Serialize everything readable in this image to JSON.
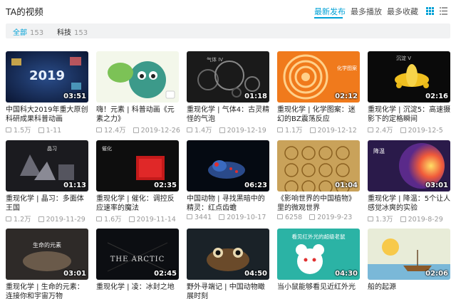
{
  "header": {
    "title": "TA的视频",
    "sort_options": [
      "最新发布",
      "最多播放",
      "最多收藏"
    ],
    "active_sort": "最新发布",
    "view_icons": [
      "grid-view-icon",
      "list-view-icon"
    ]
  },
  "filter": {
    "items": [
      {
        "label": "全部",
        "count": "153"
      },
      {
        "label": "科技",
        "count": "153"
      }
    ]
  },
  "videos": [
    {
      "title": "中国科大2019年重大原创科研成果科普动画",
      "duration": "03:51",
      "plays": "1.5万",
      "date": "1-11",
      "thumb_label": "2019"
    },
    {
      "title": "嗨！元素 | 科普动画《元素之力》",
      "duration": "",
      "plays": "12.4万",
      "date": "2019-12-26",
      "thumb_label": ""
    },
    {
      "title": "重现化学 | 气体4：古灵精怪的气泡",
      "duration": "01:18",
      "plays": "1.4万",
      "date": "2019-12-19",
      "thumb_label": "气体 IV"
    },
    {
      "title": "重现化学 | 化学图案：迷幻的BZ震荡反应",
      "duration": "02:12",
      "plays": "1.1万",
      "date": "2019-12-12",
      "thumb_label": "化学图案"
    },
    {
      "title": "重现化学 | 沉淀5：高速摄影下的定格瞬间",
      "duration": "02:16",
      "plays": "2.4万",
      "date": "2019-12-5",
      "thumb_label": "沉淀 V"
    },
    {
      "title": "重现化学 | 晶习：多面体王国",
      "duration": "01:13",
      "plays": "1.2万",
      "date": "2019-11-29",
      "thumb_label": "晶习"
    },
    {
      "title": "重现化学 | 催化：调控反应速率的魔法",
      "duration": "02:35",
      "plays": "1.6万",
      "date": "2019-11-14",
      "thumb_label": "催化"
    },
    {
      "title": "中国动物 | 寻找黑暗中的精灵：红点齿蟾",
      "duration": "06:23",
      "plays": "3441",
      "date": "2019-10-17",
      "thumb_label": ""
    },
    {
      "title": "《影响世界的中国植物》里的微观世界",
      "duration": "01:04",
      "plays": "6258",
      "date": "2019-9-23",
      "thumb_label": ""
    },
    {
      "title": "重现化学 | 降温：5个让人感觉冰爽的实验",
      "duration": "03:01",
      "plays": "1.3万",
      "date": "2019-8-29",
      "thumb_label": "降温"
    },
    {
      "title": "重现化学 | 生命的元素：连接你和宇宙万物",
      "duration": "03:01",
      "plays": "",
      "date": "",
      "thumb_label": "生命的元素"
    },
    {
      "title": "重现化学 | 凌：冰封之地",
      "duration": "02:45",
      "plays": "",
      "date": "",
      "thumb_label": "THE ARCTIC"
    },
    {
      "title": "野外寻端记 | 中国动物瞰展时刻",
      "duration": "04:50",
      "plays": "",
      "date": "",
      "thumb_label": ""
    },
    {
      "title": "当小鼠能够看见近红外光",
      "duration": "04:30",
      "plays": "",
      "date": "",
      "thumb_label": "看见红外光的超级老鼠"
    },
    {
      "title": "船的起源",
      "duration": "02:06",
      "plays": "",
      "date": "",
      "thumb_label": ""
    }
  ]
}
